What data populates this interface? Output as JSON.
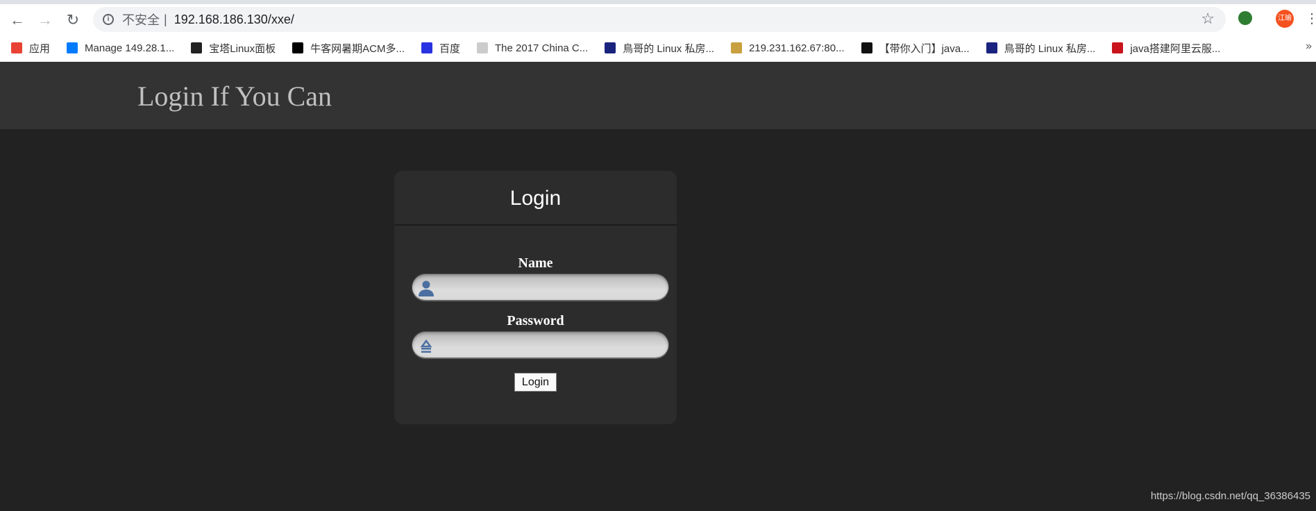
{
  "browser": {
    "url_security": "不安全",
    "url": "192.168.186.130/xxe/",
    "profile": "江瑜",
    "bookmarks": [
      {
        "label": "应用",
        "icon": "apps-grid-icon",
        "color": "#e94235"
      },
      {
        "label": "Manage 149.28.1...",
        "icon": "vultr-icon",
        "color": "#007bfc"
      },
      {
        "label": "宝塔Linux面板",
        "icon": "bt-icon",
        "color": "#222222"
      },
      {
        "label": "牛客网暑期ACM多...",
        "icon": "nowcoder-icon",
        "color": "#000000"
      },
      {
        "label": "百度",
        "icon": "baidu-paw-icon",
        "color": "#2932e1"
      },
      {
        "label": "The 2017 China C...",
        "icon": "page-icon",
        "color": "#cccccc"
      },
      {
        "label": "鳥哥的 Linux 私房...",
        "icon": "vbird-icon",
        "color": "#1a237e"
      },
      {
        "label": "219.231.162.67:80...",
        "icon": "tomcat-icon",
        "color": "#c8a040"
      },
      {
        "label": "【带你入门】java...",
        "icon": "n-icon",
        "color": "#111111"
      },
      {
        "label": "鳥哥的 Linux 私房...",
        "icon": "vbird-icon",
        "color": "#1a237e"
      },
      {
        "label": "java搭建阿里云服...",
        "icon": "csdn-c-icon",
        "color": "#c9141d"
      }
    ]
  },
  "page": {
    "site_title": "Login If You Can",
    "login": {
      "title": "Login",
      "name_label": "Name",
      "name_value": "",
      "password_label": "Password",
      "password_value": "",
      "submit": "Login"
    },
    "watermark": "https://blog.csdn.net/qq_36386435"
  }
}
